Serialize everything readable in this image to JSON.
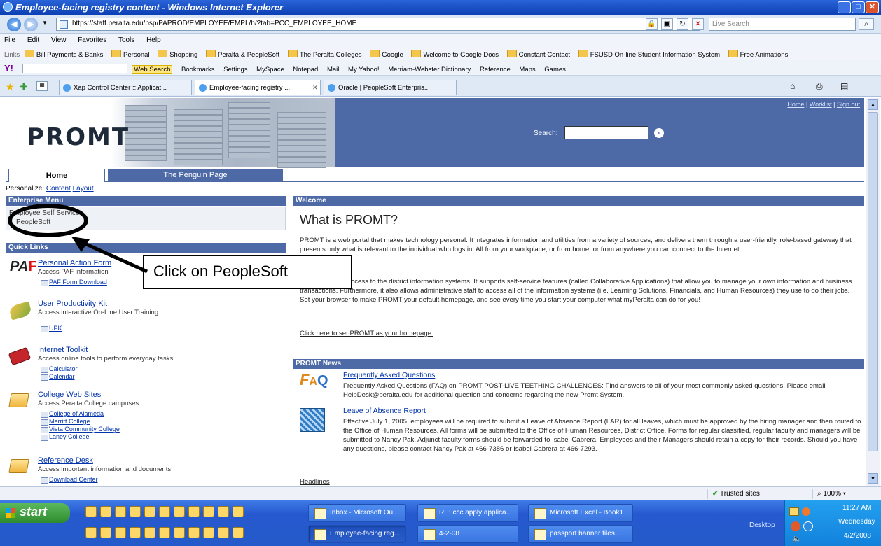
{
  "window": {
    "title": "Employee-facing registry content - Windows Internet Explorer"
  },
  "browser": {
    "address": "https://staff.peralta.edu/psp/PAPROD/EMPLOYEE/EMPL/h/?tab=PCC_EMPLOYEE_HOME",
    "search_placeholder": "Live Search",
    "menu": [
      "File",
      "Edit",
      "View",
      "Favorites",
      "Tools",
      "Help"
    ],
    "links_label": "Links",
    "links": [
      "Bill Payments & Banks",
      "Personal",
      "Shopping",
      "Peralta & PeopleSoft",
      "The Peralta Colleges",
      "Google",
      "Welcome to Google Docs",
      "Constant Contact",
      "FSUSD On-line Student Information System",
      "Free Animations"
    ],
    "yahoo_toolbar": {
      "logo": "Y!",
      "items": [
        "Web Search",
        "Bookmarks",
        "Settings",
        "MySpace",
        "Notepad",
        "Mail",
        "My Yahoo!",
        "Merriam-Webster Dictionary",
        "Reference",
        "Maps",
        "Games"
      ]
    },
    "tabs": [
      {
        "label": "Xap Control Center :: Applicat..."
      },
      {
        "label": "Employee-facing registry ...",
        "active": true
      },
      {
        "label": "Oracle | PeopleSoft Enterpris..."
      }
    ]
  },
  "portal": {
    "logo": "PROMT",
    "top_links": [
      "Home",
      "Worklist",
      "Sign out"
    ],
    "search_label": "Search:",
    "page_tabs": [
      "Home",
      "The Penguin Page"
    ],
    "personalize_label": "Personalize:",
    "personalize_links": [
      "Content",
      "Layout"
    ],
    "enterprise_menu": {
      "title": "Enterprise Menu",
      "items": [
        "Employee Self Service",
        "PeopleSoft"
      ]
    },
    "quick_links": {
      "title": "Quick Links",
      "items": [
        {
          "title": "Personal Action Form",
          "desc": "Access PAF information",
          "subs": [
            "PAF Form Download"
          ]
        },
        {
          "title": "User Productivity Kit",
          "desc": "Access interactive On-Line User Training",
          "subs": [
            "UPK"
          ]
        },
        {
          "title": "Internet Toolkit",
          "desc": "Access online tools to perform everyday tasks",
          "subs": [
            "Calculator",
            "Calendar"
          ]
        },
        {
          "title": "College Web Sites",
          "desc": "Access Peralta College campuses",
          "subs": [
            "College of Alameda",
            "Merritt College",
            "Vista Community College",
            "Laney College"
          ]
        },
        {
          "title": "Reference Desk",
          "desc": "Access important information and documents",
          "subs": [
            "Download Center"
          ]
        }
      ]
    },
    "welcome": {
      "header": "Welcome",
      "title": "What is PROMT?",
      "p1": "PROMT is a web portal that makes technology personal. It integrates information and utilities from a variety of sources, and delivers them through a user-friendly, role-based gateway that presents only what is relevant to the individual who logs in. All from your workplace, or from home, or from anywhere you can connect to the Internet.",
      "p2": "PROMT is your access to the district information systems. It supports self-service features (called Collaborative Applications) that allow you to manage your own information and business transactions. Furthermore, it also allows administrative staff to access all of the information systems (i.e. Learning Solutions, Financials, and Human Resources) they use to do their jobs. Set your browser to make PROMT your default homepage, and see every time you start your computer what myPeralta can do for you!",
      "homepage_link": "Click here to set PROMT as your homepage."
    },
    "news": {
      "header": "PROMT News",
      "items": [
        {
          "title": "Frequently Asked Questions",
          "text": "Frequently Asked Questions (FAQ) on PROMT POST-LIVE TEETHING CHALLENGES: Find answers to all of your most commonly asked questions. Please email HelpDesk@peralta.edu for additional question and concerns regarding the new Promt System."
        },
        {
          "title": "Leave of Absence Report",
          "text": "Effective July 1, 2005, employees will be required to submit a Leave of Absence Report (LAR) for all leaves, which must be approved by the hiring manager and then routed to the Office of Human Resources. All forms will be submitted to the Office of Human Resources, District Office. Forms for regular classified, regular faculty and managers will be submitted to Nancy Pak. Adjunct faculty forms should be forwarded to Isabel Cabrera. Employees and their Managers should retain a copy for their records. Should you have any questions, please contact Nancy Pak at 466-7386 or Isabel Cabrera at 466-7293."
        }
      ],
      "headlines_link": "Headlines"
    },
    "callout": "Click on PeopleSoft"
  },
  "statusbar": {
    "zone": "Trusted sites",
    "zoom": "100%"
  },
  "taskbar": {
    "start": "start",
    "tasks_row1": [
      "Inbox - Microsoft Ou...",
      "RE: ccc apply applica...",
      "Microsoft Excel - Book1"
    ],
    "tasks_row2": [
      "Employee-facing reg...",
      "4-2-08",
      "passport banner files..."
    ],
    "desktop_label": "Desktop",
    "clock": {
      "time": "11:27 AM",
      "day": "Wednesday",
      "date": "4/2/2008"
    }
  }
}
